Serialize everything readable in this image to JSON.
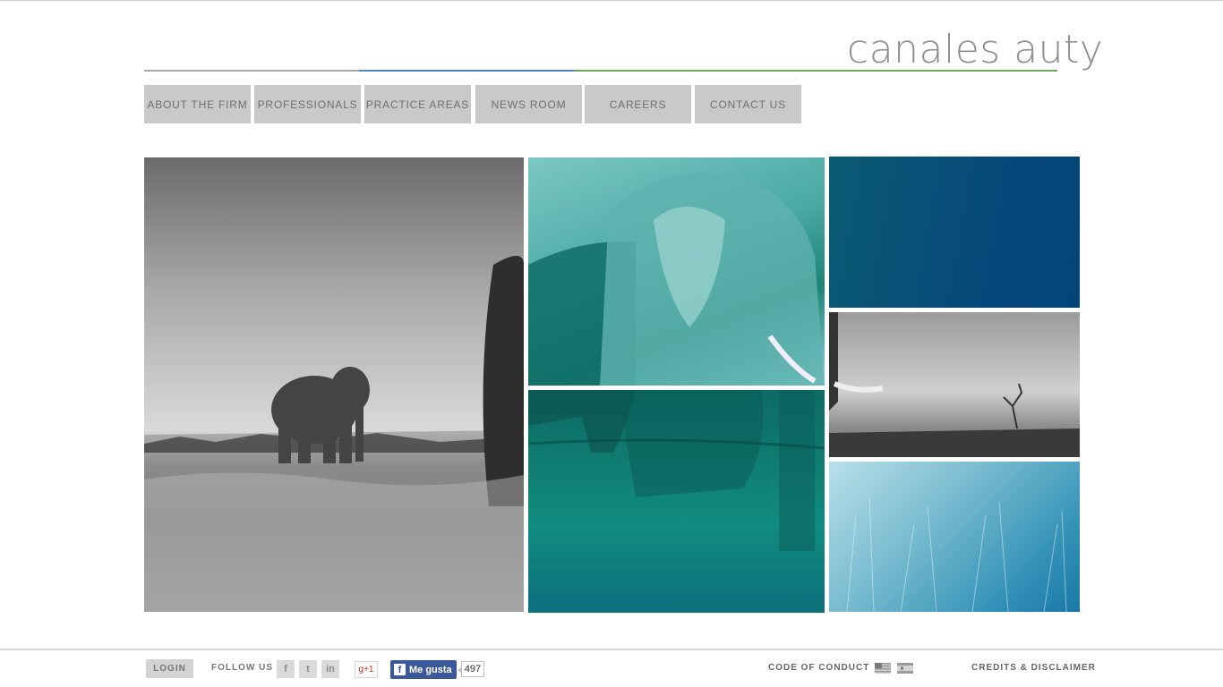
{
  "brand": {
    "logo_text": "canales auty"
  },
  "nav": {
    "items": [
      {
        "label": "ABOUT THE FIRM"
      },
      {
        "label": "PROFESSIONALS"
      },
      {
        "label": "PRACTICE AREAS"
      },
      {
        "label": "NEWS ROOM"
      },
      {
        "label": "CAREERS"
      },
      {
        "label": "CONTACT US"
      }
    ]
  },
  "colors": {
    "rule_gray": "#a9a9a9",
    "rule_blue": "#4a86c8",
    "rule_green": "#6aa85a",
    "nav_bg": "#c9c9cc",
    "teal": "#0f7b6e",
    "deep_blue": "#06477a"
  },
  "footer": {
    "login_label": "LOGIN",
    "follow_label": "FOLLOW US",
    "social": [
      {
        "name": "facebook-icon",
        "glyph": "f"
      },
      {
        "name": "twitter-icon",
        "glyph": "t"
      },
      {
        "name": "linkedin-icon",
        "glyph": "in"
      }
    ],
    "gplus_label": "g+1",
    "fb_like_label": "Me gusta",
    "fb_like_count": "497",
    "code_of_conduct": "CODE OF CONDUCT",
    "credits": "CREDITS & DISCLAIMER"
  }
}
